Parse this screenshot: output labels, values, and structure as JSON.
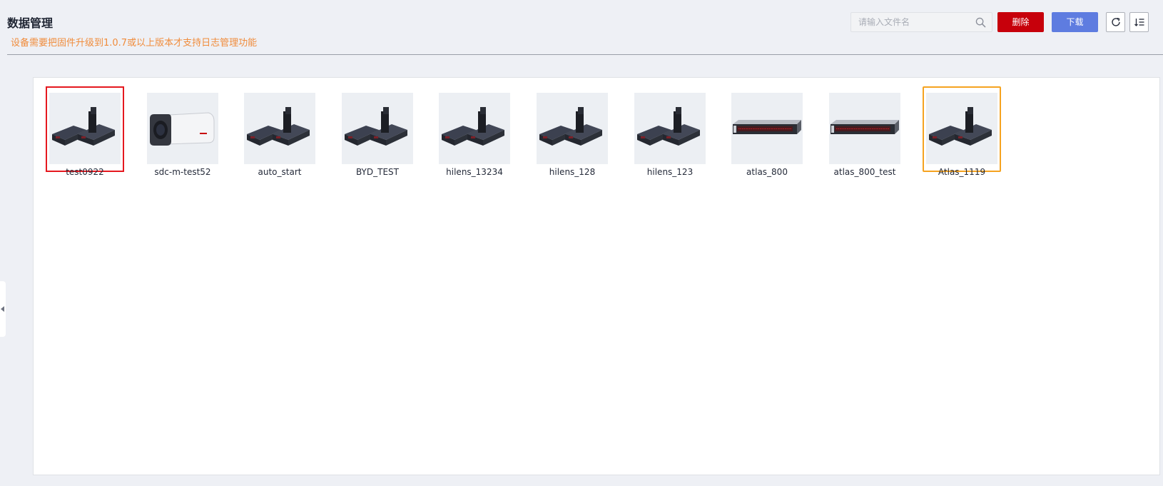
{
  "header": {
    "title": "数据管理",
    "notice": "设备需要把固件升级到1.0.7或以上版本才支持日志管理功能"
  },
  "toolbar": {
    "search_placeholder": "请输入文件名",
    "delete_label": "删除",
    "download_label": "下载",
    "refresh_icon": "refresh-icon",
    "sort_icon": "sort-icon"
  },
  "colors": {
    "delete": "#c7000b",
    "download": "#5e7ce0",
    "notice": "#f08c3c",
    "selected_red": "#e5181f",
    "selected_orange": "#f5a320"
  },
  "devices": [
    {
      "name": "test0922",
      "image": "hilens-kit",
      "state": "selected-red"
    },
    {
      "name": "sdc-m-test52",
      "image": "bullet-camera",
      "state": "normal"
    },
    {
      "name": "auto_start",
      "image": "hilens-kit",
      "state": "normal"
    },
    {
      "name": "BYD_TEST",
      "image": "hilens-kit",
      "state": "normal"
    },
    {
      "name": "hilens_13234",
      "image": "hilens-kit",
      "state": "normal"
    },
    {
      "name": "hilens_128",
      "image": "hilens-kit",
      "state": "normal"
    },
    {
      "name": "hilens_123",
      "image": "hilens-kit",
      "state": "normal"
    },
    {
      "name": "atlas_800",
      "image": "rack-server",
      "state": "normal"
    },
    {
      "name": "atlas_800_test",
      "image": "rack-server",
      "state": "normal"
    },
    {
      "name": "Atlas_1119",
      "image": "hilens-kit",
      "state": "selected-orange"
    }
  ]
}
